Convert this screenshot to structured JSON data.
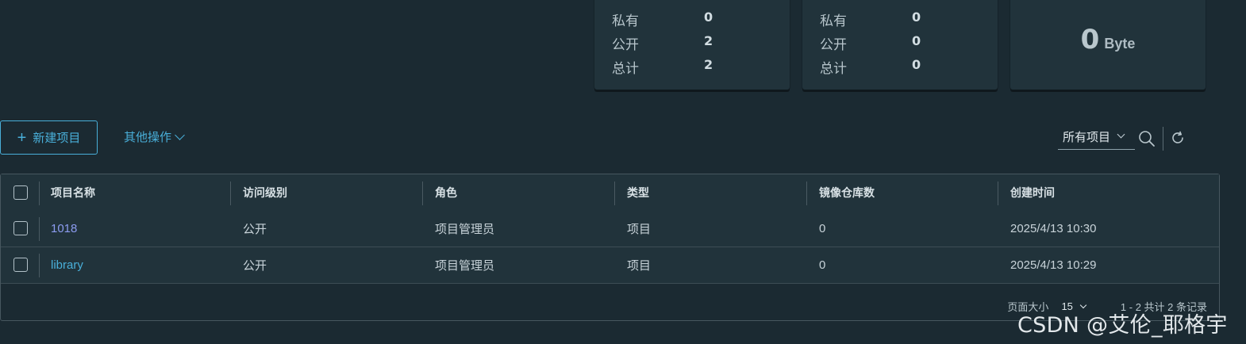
{
  "stats": {
    "projects": {
      "private_label": "私有",
      "private_value": "0",
      "public_label": "公开",
      "public_value": "2",
      "total_label": "总计",
      "total_value": "2"
    },
    "repos": {
      "private_label": "私有",
      "private_value": "0",
      "public_label": "公开",
      "public_value": "0",
      "total_label": "总计",
      "total_value": "0"
    },
    "storage": {
      "value": "0",
      "unit": "Byte"
    }
  },
  "toolbar": {
    "new_project_label": "新建项目",
    "more_actions_label": "其他操作",
    "filter_value": "所有项目"
  },
  "table": {
    "headers": [
      "项目名称",
      "访问级别",
      "角色",
      "类型",
      "镜像仓库数",
      "创建时间"
    ],
    "rows": [
      {
        "name": "1018",
        "access": "公开",
        "role": "项目管理员",
        "type": "项目",
        "repos": "0",
        "created": "2025/4/13 10:30"
      },
      {
        "name": "library",
        "access": "公开",
        "role": "项目管理员",
        "type": "项目",
        "repos": "0",
        "created": "2025/4/13 10:29"
      }
    ],
    "footer": {
      "page_size_label": "页面大小",
      "page_size_value": "15",
      "summary": "1 - 2 共计 2 条记录"
    }
  },
  "watermark": "CSDN @艾伦_耶格宇",
  "colors": {
    "background": "#1b2a32",
    "card": "#21333b",
    "accent": "#49afd9",
    "visited_link": "#8c9cf0"
  },
  "icons": [
    "plus-icon",
    "chevron-down-icon",
    "search-icon",
    "refresh-icon"
  ]
}
